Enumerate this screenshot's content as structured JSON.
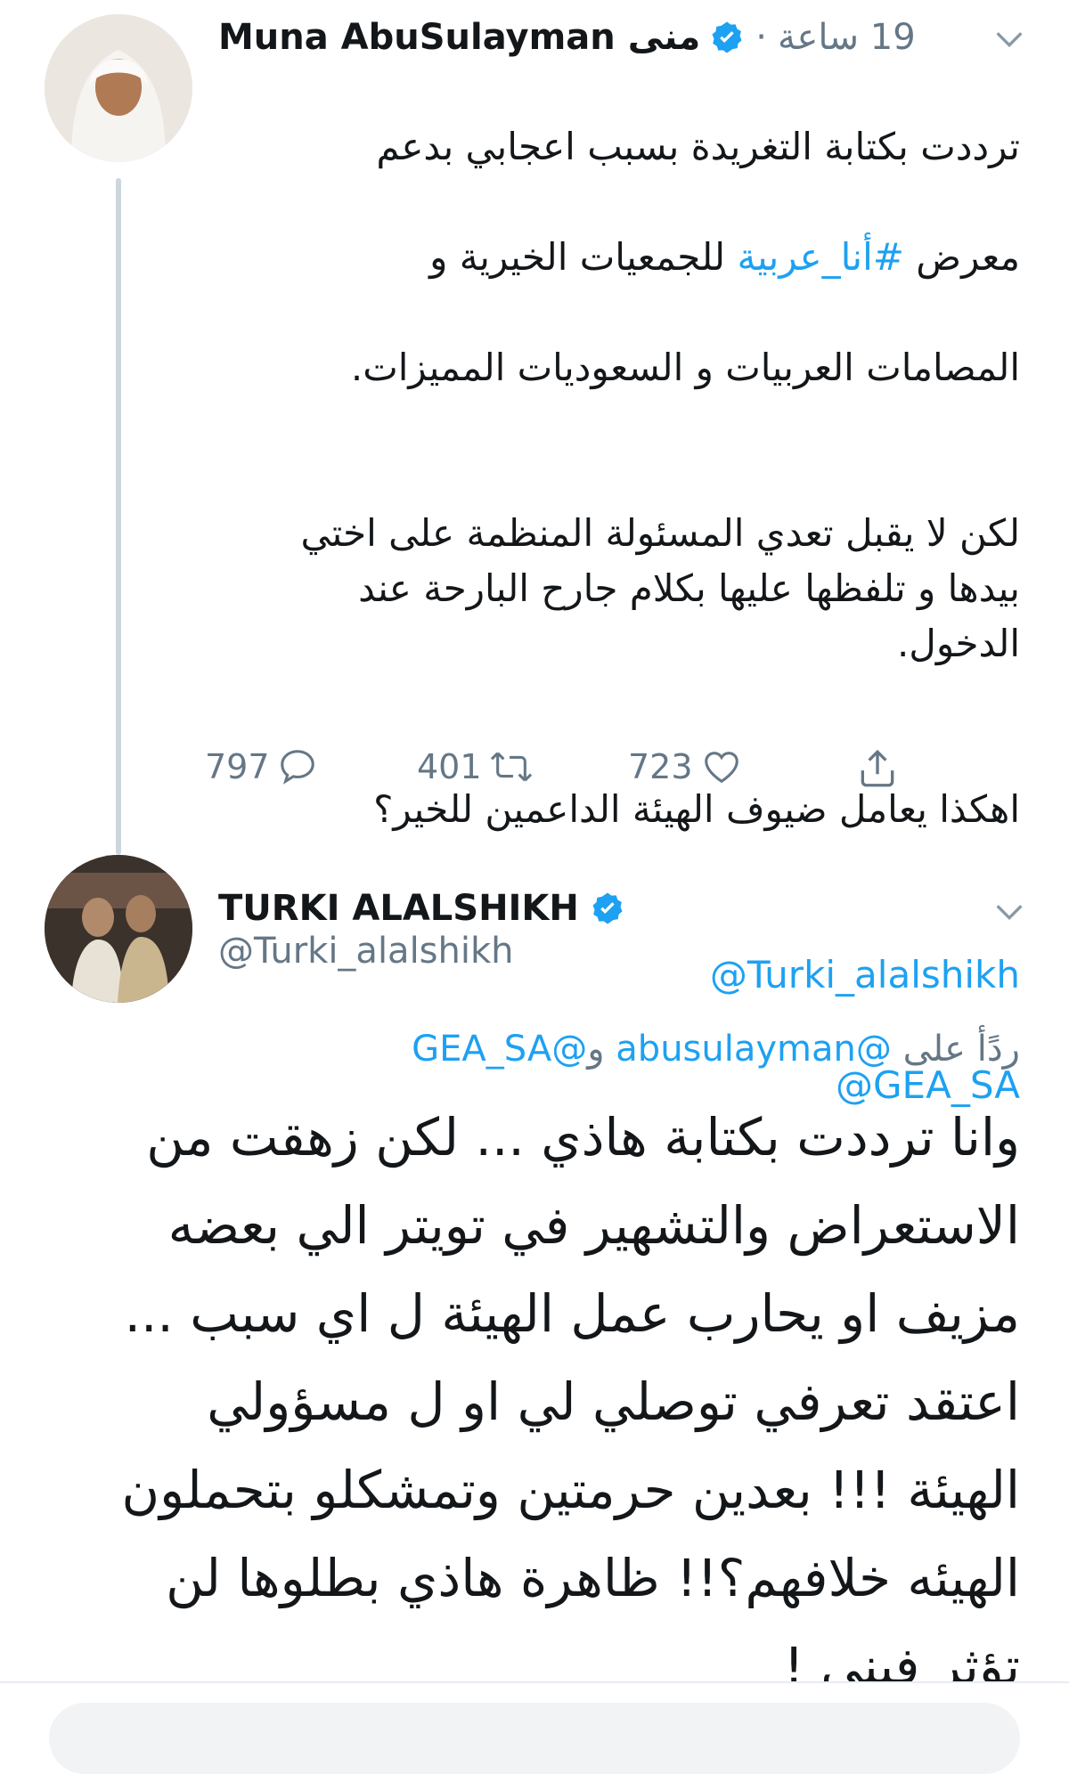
{
  "tweet1": {
    "display_name": "Muna AbuSulayman",
    "arabic_name": "منى",
    "timestamp": "19 ساعة",
    "dot": "·",
    "line1": "ترددت بكتابة التغريدة بسبب اعجابي بدعم",
    "line2_prefix": "معرض ",
    "hashtag": "#أنا_عربية",
    "line2_suffix": " للجمعيات الخيرية و",
    "line3": "المصامات العربيات و السعوديات المميزات.",
    "para2": "لكن لا يقبل تعدي المسئولة المنظمة على اختي\nبيدها و تلفظها عليها بكلام جارح البارحة عند\nالدخول.",
    "para3": "اهكذا يعامل ضيوف الهيئة الداعمين للخير؟",
    "mention1": "@Turki_alalshikh",
    "mention2": "@GEA_SA",
    "replies": "797",
    "retweets": "401",
    "likes": "723"
  },
  "tweet2": {
    "display_name": "TURKI ALALSHIKH",
    "handle": "@Turki_alalshikh",
    "reply_to_prefix": "ردًأ على ",
    "reply_to_mention1": "@abusulayman",
    "reply_to_and": " و",
    "reply_to_mention2": "@GEA_SA",
    "body": "وانا ترددت بكتابة هاذي ... لكن زهقت من\nالاستعراض والتشهير في تويتر الي بعضه\nمزيف او يحارب عمل الهيئة ل اي سبب ...\nاعتقد تعرفي توصلي لي او ل مسؤولي\nالهيئة !!! بعدين حرمتين وتمشكلو بتحملون\nالهيئه خلافهم؟!! ظاهرة هاذي بطلوها لن\nتؤثر فيني !"
  },
  "colors": {
    "accent": "#1da1f2",
    "muted": "#657786",
    "text": "#14171a"
  }
}
